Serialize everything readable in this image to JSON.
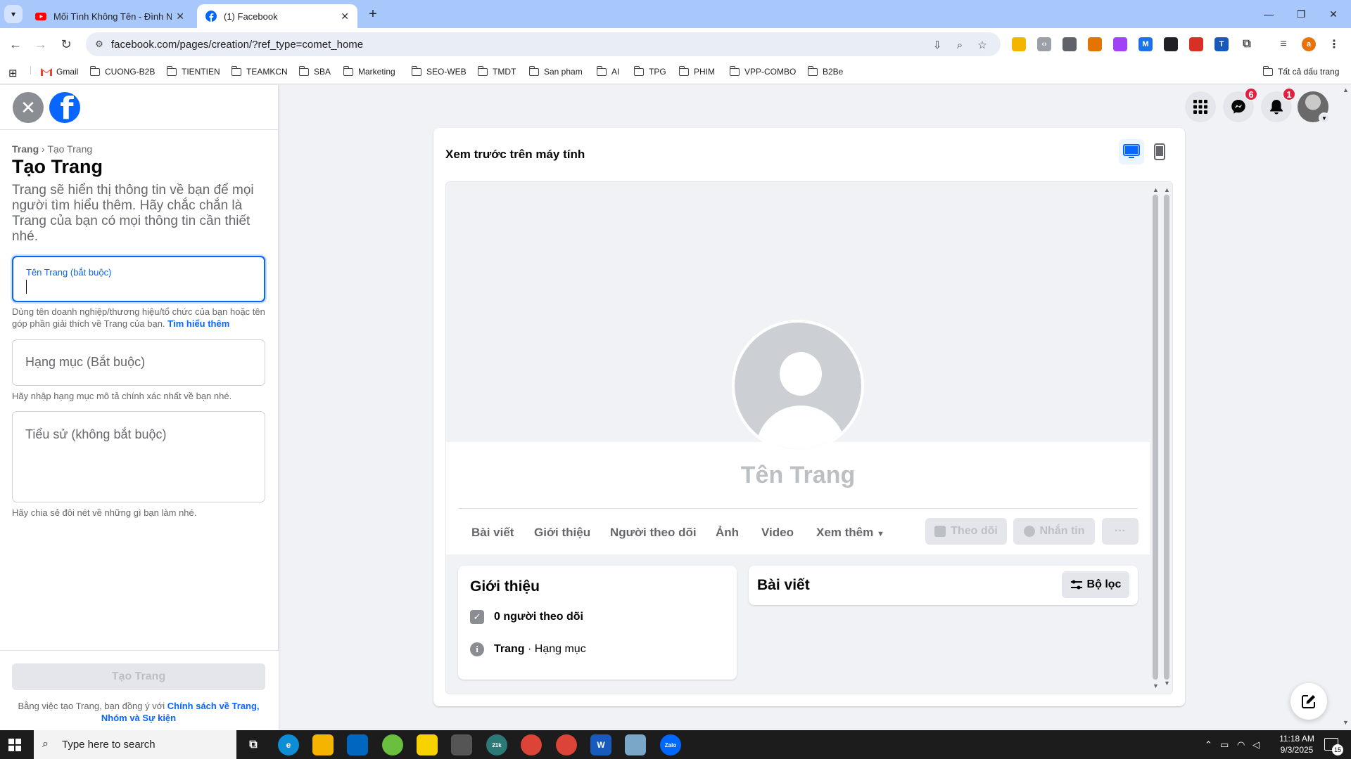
{
  "browser": {
    "tabs": [
      {
        "label": "Mối Tình Không Tên - Đình Ng",
        "favicon": "youtube-icon",
        "active": false
      },
      {
        "label": "(1) Facebook",
        "favicon": "facebook-icon",
        "active": true
      }
    ],
    "url": "facebook.com/pages/creation/?ref_type=comet_home",
    "bookmarks": [
      "Gmail",
      "CUONG-B2B",
      "TIENTIEN",
      "TEAMKCN",
      "SBA",
      "Marketing",
      "SEO-WEB",
      "TMDT",
      "San pham",
      "AI",
      "TPG",
      "PHIM",
      "VPP-COMBO",
      "B2Be"
    ],
    "all_bookmarks_label": "Tất cả dấu trang"
  },
  "left_panel": {
    "breadcrumb_parent": "Trang",
    "breadcrumb_separator": "›",
    "breadcrumb_current": "Tạo Trang",
    "title": "Tạo Trang",
    "description": "Trang sẽ hiển thị thông tin về bạn để mọi người tìm hiểu thêm. Hãy chắc chắn là Trang của bạn có mọi thông tin cần thiết nhé.",
    "name_field": {
      "label": "Tên Trang (bắt buộc)",
      "value": "",
      "help": "Dùng tên doanh nghiệp/thương hiệu/tổ chức của bạn hoặc tên góp phần giải thích về Trang của bạn.",
      "help_link": "Tìm hiểu thêm"
    },
    "category_field": {
      "placeholder": "Hạng mục (Bắt buộc)",
      "help": "Hãy nhập hạng mục mô tả chính xác nhất về bạn nhé."
    },
    "bio_field": {
      "placeholder": "Tiểu sử (không bắt buộc)",
      "help": "Hãy chia sẻ đôi nét về những gì bạn làm nhé."
    },
    "create_button": "Tạo Trang",
    "terms_text": "Bằng việc tạo Trang, bạn đồng ý với",
    "terms_link": "Chính sách về Trang, Nhóm và Sự kiện"
  },
  "top_nav": {
    "messenger_badge": "6",
    "notifications_badge": "1"
  },
  "preview": {
    "title": "Xem trước trên máy tính",
    "page_name": "Tên Trang",
    "tabs": [
      "Bài viết",
      "Giới thiệu",
      "Người theo dõi",
      "Ảnh",
      "Video",
      "Xem thêm"
    ],
    "actions": {
      "follow": "Theo dõi",
      "message": "Nhắn tin",
      "more": "···"
    },
    "intro": {
      "title": "Giới thiệu",
      "followers": "0 người theo dõi",
      "type_bold": "Trang",
      "type_rest": " · Hạng mục"
    },
    "posts": {
      "title": "Bài viết",
      "filter": "Bộ lọc"
    }
  },
  "taskbar": {
    "search_placeholder": "Type here to search",
    "time": "11:18 AM",
    "date": "9/3/2025",
    "notification_count": "15",
    "chrome_badge": "21k"
  },
  "colors": {
    "fb_blue": "#0866ff",
    "badge_red": "#e41e3f",
    "tab_strip": "#a8c7fa"
  }
}
